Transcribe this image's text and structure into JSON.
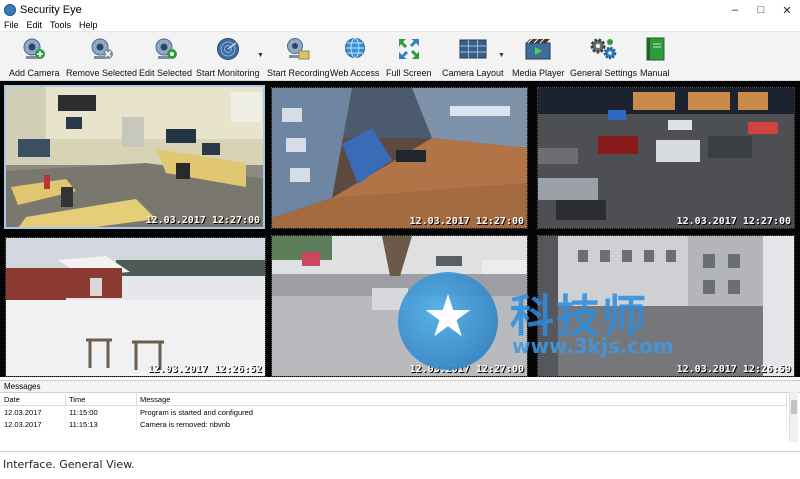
{
  "window": {
    "title": "Security Eye",
    "controls": [
      "–",
      "□",
      "✕"
    ]
  },
  "menu": [
    {
      "label": "File"
    },
    {
      "label": "Edit"
    },
    {
      "label": "Tools"
    },
    {
      "label": "Help"
    }
  ],
  "toolbar": {
    "buttons": [
      {
        "label": "Add Camera",
        "icon": "add-camera-icon"
      },
      {
        "label": "Remove Selected",
        "icon": "remove-camera-icon"
      },
      {
        "label": "Edit Selected",
        "icon": "edit-camera-icon"
      },
      {
        "label": "Start Monitoring",
        "icon": "radar-icon"
      },
      {
        "label": "Start Recording",
        "icon": "record-icon"
      },
      {
        "label": "Web Access",
        "icon": "globe-icon"
      },
      {
        "label": "Full Screen",
        "icon": "fullscreen-icon"
      },
      {
        "label": "Camera Layout",
        "icon": "layout-icon"
      },
      {
        "label": "Media Player",
        "icon": "media-player-icon"
      },
      {
        "label": "General Settings",
        "icon": "gear-icon"
      },
      {
        "label": "Manual",
        "icon": "manual-book-icon"
      }
    ]
  },
  "cameras": [
    {
      "timestamp": "12.03.2017 12:27:00",
      "selected": true
    },
    {
      "timestamp": "12.03.2017 12:27:00",
      "selected": false
    },
    {
      "timestamp": "12.03.2017 12:27:00",
      "selected": false
    },
    {
      "timestamp": "12.03.2017 12:26:52",
      "selected": false
    },
    {
      "timestamp": "12.03.2017 12:27:00",
      "selected": false
    },
    {
      "timestamp": "12.03.2017 12:26:59",
      "selected": false
    }
  ],
  "watermark": {
    "text": "科技师",
    "url": "www.3kjs.com"
  },
  "messages": {
    "title": "Messages",
    "columns": [
      "Date",
      "Time",
      "Message"
    ],
    "rows": [
      [
        "12.03.2017",
        "11:15:00",
        "Program is started and configured"
      ],
      [
        "12.03.2017",
        "11:15:13",
        "Camera is removed: nbvnb"
      ]
    ]
  },
  "caption": "Interface. General View.",
  "colors": {
    "accent": "#3a78c0",
    "selection": "#a9c8ea",
    "watermark": "#2a8ee0"
  }
}
